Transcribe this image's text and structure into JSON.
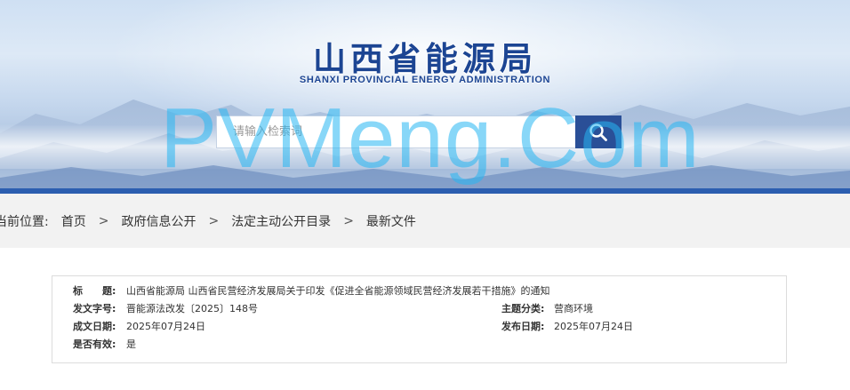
{
  "header": {
    "logo_cn": "山西省能源局",
    "logo_en": "SHANXI PROVINCIAL ENERGY ADMINISTRATION",
    "search_placeholder": "请输入检索词",
    "watermark": "PVMeng.Com"
  },
  "breadcrumb": {
    "prefix": "当前位置:",
    "separator": ">",
    "items": [
      "首页",
      "政府信息公开",
      "法定主动公开目录",
      "最新文件"
    ]
  },
  "document_info": {
    "title_label": "标　　题:",
    "title_value": "山西省能源局 山西省民营经济发展局关于印发《促进全省能源领域民营经济发展若干措施》的通知",
    "doc_number_label": "发文字号:",
    "doc_number_value": "晋能源法改发〔2025〕148号",
    "topic_label": "主题分类:",
    "topic_value": "营商环境",
    "created_label": "成文日期:",
    "created_value": "2025年07月24日",
    "published_label": "发布日期:",
    "published_value": "2025年07月24日",
    "valid_label": "是否有效:",
    "valid_value": "是"
  },
  "colors": {
    "brand_blue": "#1c4593",
    "search_button": "#2a4f97",
    "stripe": "#2c5eb0",
    "breadcrumb_bg": "#f2f2f2",
    "watermark": "#26b7f3"
  },
  "icons": {
    "search_button_icon": "search-icon"
  }
}
